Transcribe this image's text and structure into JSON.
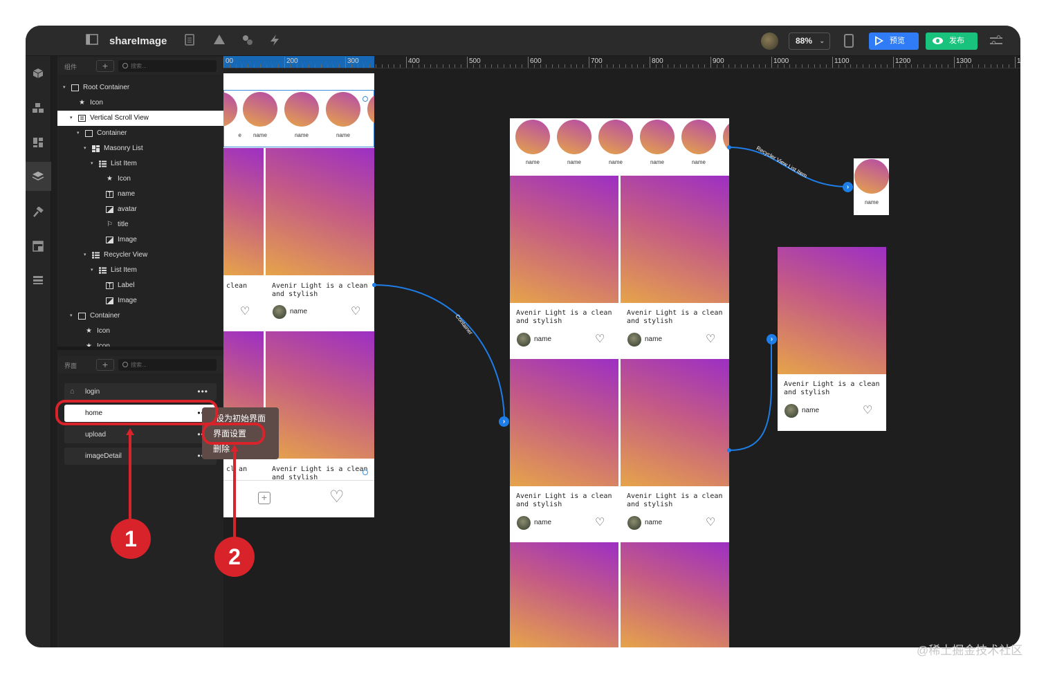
{
  "app": {
    "title": "shareImage",
    "zoom": "88%",
    "preview_label": "预览",
    "publish_label": "发布"
  },
  "components_panel": {
    "header_label": "组件",
    "search_placeholder": "搜索...",
    "tree": [
      {
        "label": "Root Container",
        "icon": "box-icon",
        "arrow": "▾",
        "indent": 0
      },
      {
        "label": "Icon",
        "icon": "star-icon",
        "arrow": "",
        "indent": 1
      },
      {
        "label": "Vertical Scroll View",
        "icon": "scroll-view-icon",
        "arrow": "▾",
        "indent": 1,
        "selected": true
      },
      {
        "label": "Container",
        "icon": "box-icon",
        "arrow": "▾",
        "indent": 2
      },
      {
        "label": "Masonry List",
        "icon": "masonry-icon",
        "arrow": "▾",
        "indent": 3
      },
      {
        "label": "List Item",
        "icon": "list-item-icon",
        "arrow": "▾",
        "indent": 4
      },
      {
        "label": "Icon",
        "icon": "star-icon",
        "arrow": "",
        "indent": 5
      },
      {
        "label": "name",
        "icon": "text-icon",
        "arrow": "",
        "indent": 5
      },
      {
        "label": "avatar",
        "icon": "image-icon",
        "arrow": "",
        "indent": 5
      },
      {
        "label": "title",
        "icon": "flag-icon",
        "arrow": "",
        "indent": 5
      },
      {
        "label": "Image",
        "icon": "image-icon",
        "arrow": "",
        "indent": 5
      },
      {
        "label": "Recycler View",
        "icon": "list-item-icon",
        "arrow": "▾",
        "indent": 3
      },
      {
        "label": "List Item",
        "icon": "list-item-icon",
        "arrow": "▾",
        "indent": 4
      },
      {
        "label": "Label",
        "icon": "text-icon",
        "arrow": "",
        "indent": 5
      },
      {
        "label": "Image",
        "icon": "image-icon",
        "arrow": "",
        "indent": 5
      },
      {
        "label": "Container",
        "icon": "box-icon",
        "arrow": "▾",
        "indent": 1
      },
      {
        "label": "Icon",
        "icon": "star-icon",
        "arrow": "",
        "indent": 2
      },
      {
        "label": "Icon",
        "icon": "star-icon",
        "arrow": "",
        "indent": 2
      }
    ]
  },
  "pages_panel": {
    "header_label": "界面",
    "search_placeholder": "搜索...",
    "pages": [
      {
        "label": "login",
        "home": true
      },
      {
        "label": "home",
        "highlighted": true
      },
      {
        "label": "upload"
      },
      {
        "label": "imageDetail"
      }
    ]
  },
  "context_menu": {
    "items": [
      "设为初始界面",
      "界面设置",
      "删除"
    ]
  },
  "ruler": {
    "ticks": [
      "00",
      "200",
      "300",
      "400",
      "500",
      "600",
      "700",
      "800",
      "900",
      "1000",
      "1100",
      "1200",
      "1300",
      "140"
    ]
  },
  "canvas": {
    "name_label": "name",
    "card_title": "Avenir Light is a clean and stylish",
    "username": "name",
    "partial_title": "clean",
    "partial_title_2": "cl  an",
    "connectors": {
      "container": "Container",
      "recycler": "Recycler View List Item"
    }
  },
  "annotations": {
    "step1": "1",
    "step2": "2"
  },
  "watermark": "@稀土掘金技术社区",
  "colors": {
    "accent_blue": "#2f7cf6",
    "publish_green": "#19c37d",
    "annotation_red": "#d9232a"
  }
}
